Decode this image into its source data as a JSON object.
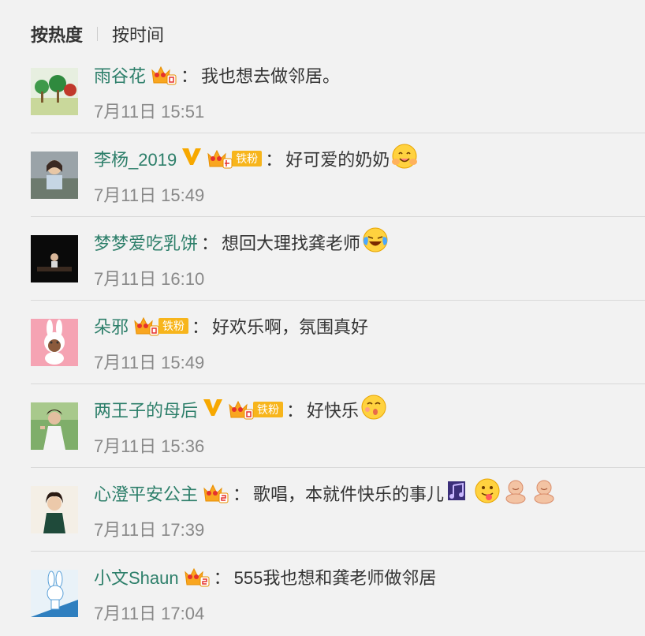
{
  "sort": {
    "hot_label": "按热度",
    "time_label": "按时间"
  },
  "comments": [
    {
      "name": "雨谷花",
      "fan_badge": "",
      "text": "我也想去做邻居。",
      "time": "7月11日 15:51"
    },
    {
      "name": "李杨_2019",
      "fan_badge": "铁粉",
      "text": "好可爱的奶奶",
      "time": "7月11日 15:49"
    },
    {
      "name": "梦梦爱吃乳饼",
      "fan_badge": "",
      "text": "想回大理找龚老师",
      "time": "7月11日 16:10"
    },
    {
      "name": "朵邪",
      "fan_badge": "铁粉",
      "text": "好欢乐啊，氛围真好",
      "time": "7月11日 15:49"
    },
    {
      "name": "两王子的母后",
      "fan_badge": "铁粉",
      "text": "好快乐",
      "time": "7月11日 15:36"
    },
    {
      "name": "心澄平安公主",
      "fan_badge": "",
      "text": "歌唱，本就件快乐的事儿",
      "time": "7月11日 17:39"
    },
    {
      "name": "小文Shaun",
      "fan_badge": "",
      "text": "555我也想和龚老师做邻居",
      "time": "7月11日 17:04"
    }
  ],
  "colors": {
    "username": "#2d7f6a",
    "fan_badge_bg": "#f7b51c",
    "verified": "#f7a800"
  }
}
